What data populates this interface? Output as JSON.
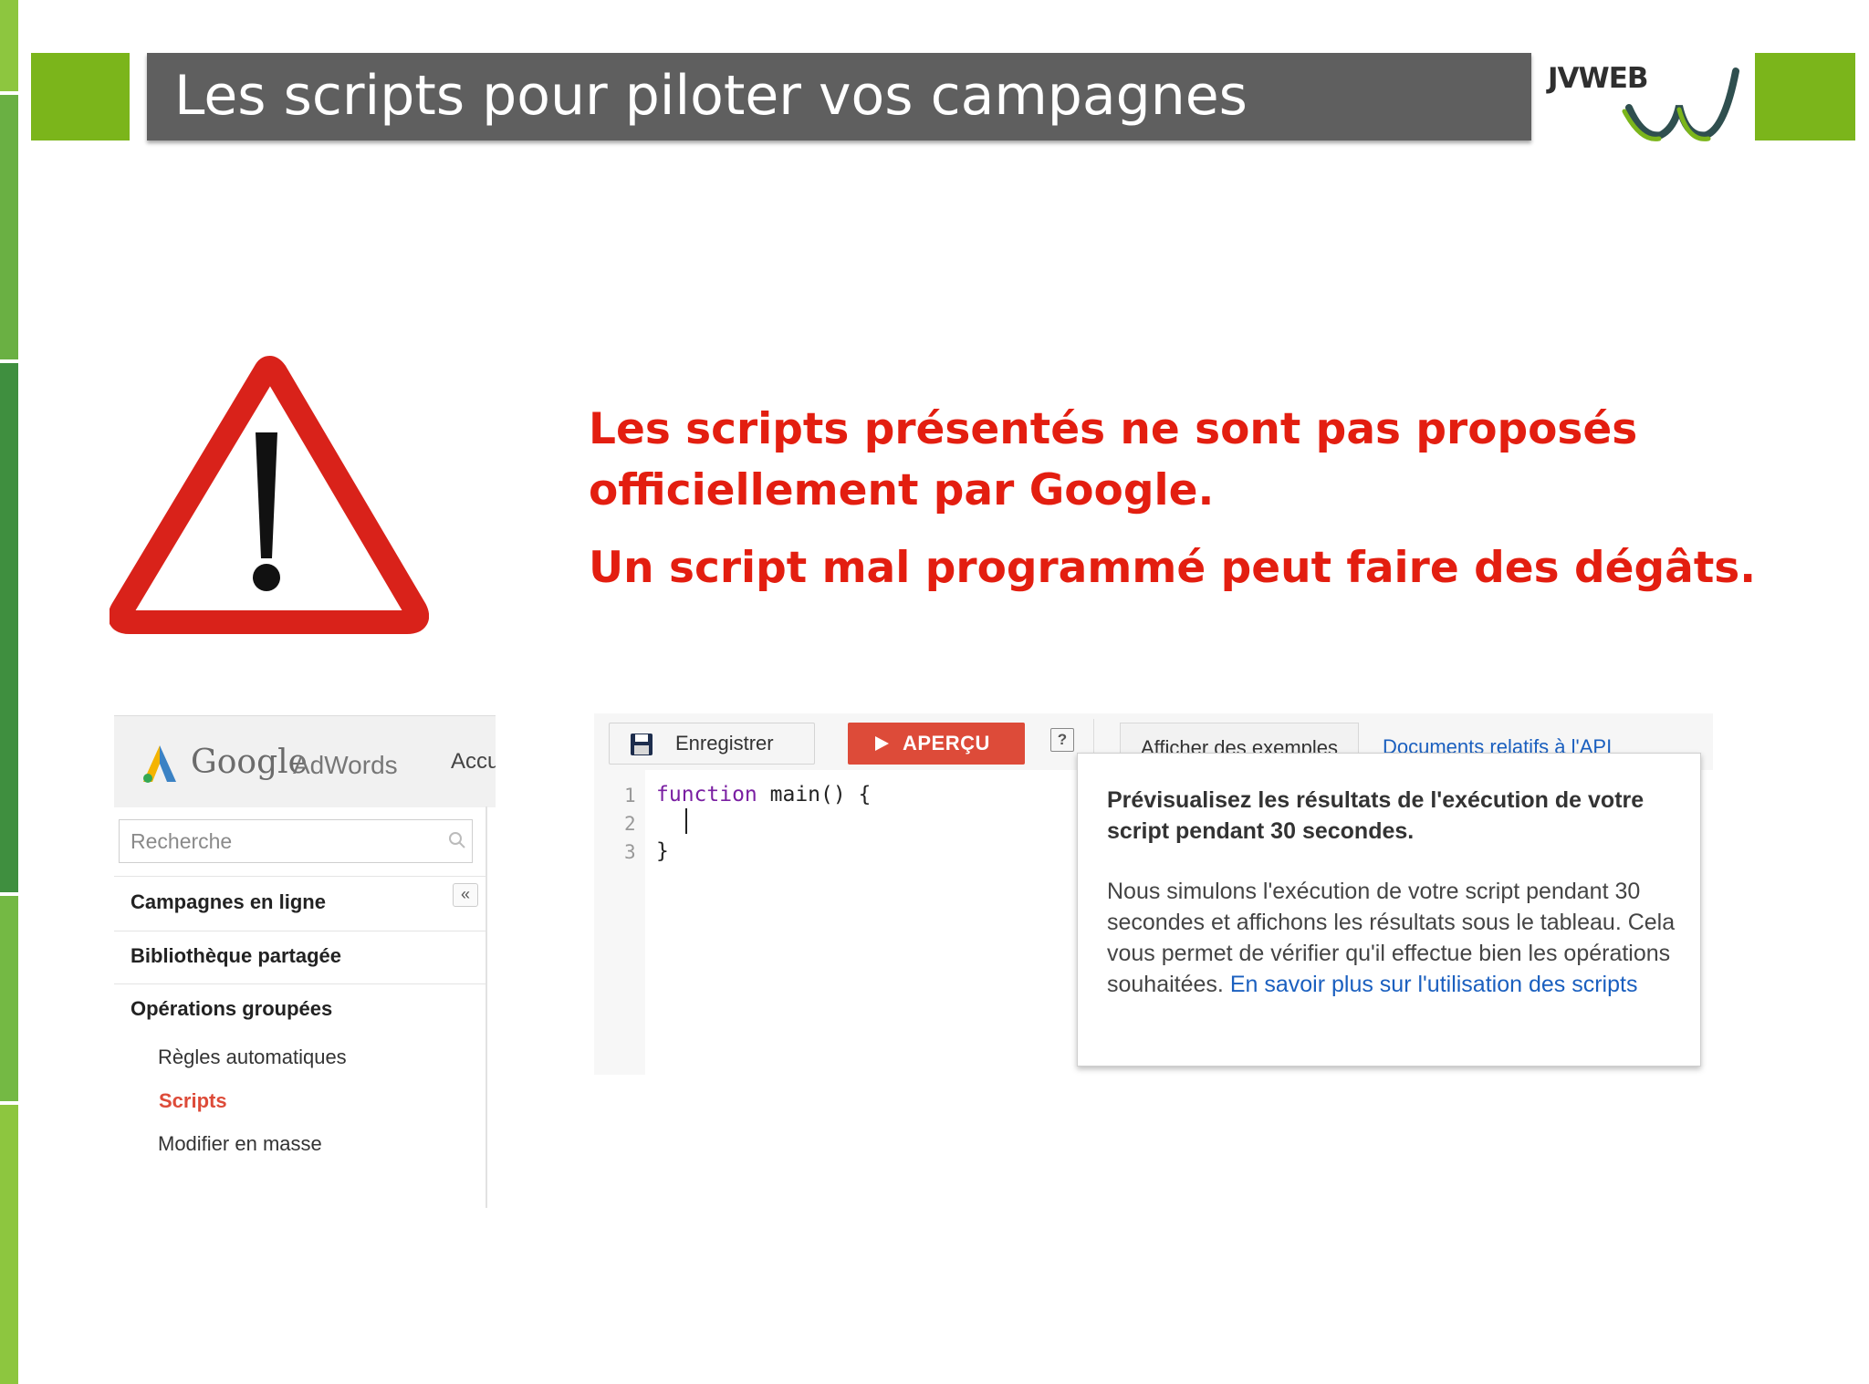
{
  "slide": {
    "title": "Les scripts pour piloter vos campagnes",
    "logo_text": "JVWEB",
    "accent_color": "#7bb51b",
    "title_bar_color": "#5f5f5f"
  },
  "warning": {
    "line1": "Les scripts présentés ne sont pas proposés",
    "line2": "officiellement par Google.",
    "line3": "Un script mal programmé peut faire des dégâts.",
    "color": "#e31e10"
  },
  "adwords": {
    "brand_google": "Google",
    "brand_adwords": "AdWords",
    "header_tab_partial": "Accu",
    "search_placeholder": "Recherche",
    "collapse_icon": "«",
    "nav": [
      {
        "label": "Campagnes en ligne"
      },
      {
        "label": "Bibliothèque partagée"
      },
      {
        "label": "Opérations groupées"
      }
    ],
    "subnav": [
      {
        "label": "Règles automatiques",
        "active": false
      },
      {
        "label": "Scripts",
        "active": true
      },
      {
        "label": "Modifier en masse",
        "active": false
      }
    ]
  },
  "editor": {
    "save_label": "Enregistrer",
    "preview_label": "APERÇU",
    "help_label": "?",
    "examples_tab": "Afficher des exemples",
    "api_docs_link": "Documents relatifs à l'API",
    "code_lines": [
      {
        "num": "1",
        "keyword": "function",
        "rest": " main() {"
      },
      {
        "num": "2",
        "keyword": "",
        "rest": ""
      },
      {
        "num": "3",
        "keyword": "",
        "rest": "}"
      }
    ]
  },
  "popup": {
    "title": "Prévisualisez les résultats de l'exécution de votre script pendant 30 secondes.",
    "body": "Nous simulons l'exécution de votre script pendant 30 secondes et affichons les résultats sous le tableau. Cela vous permet de vérifier qu'il effectue bien les opérations souhaitées. ",
    "link": "En savoir plus sur l'utilisation des scripts"
  }
}
